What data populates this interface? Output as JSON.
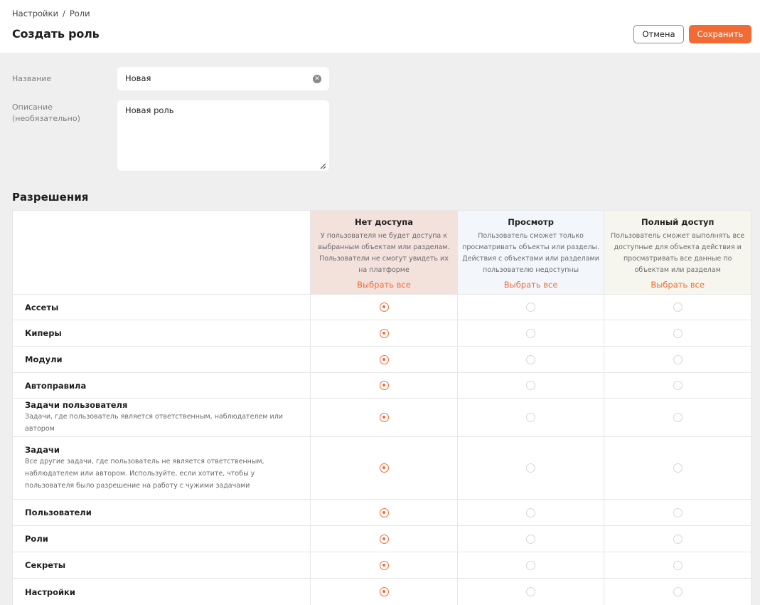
{
  "breadcrumb": {
    "parent": "Настройки",
    "separator": "/",
    "current": "Роли"
  },
  "page_title": "Создать роль",
  "actions": {
    "cancel_label": "Отмена",
    "save_label": "Сохранить"
  },
  "colors": {
    "accent": "#f26b35",
    "no_access_bg": "#f3e1dc",
    "view_bg": "#f3f7fc",
    "full_bg": "#f6f6ee"
  },
  "form": {
    "name_label": "Название",
    "name_value": "Новая",
    "description_label_1": "Описание",
    "description_label_2": "(необязательно)",
    "description_value": "Новая роль"
  },
  "permissions": {
    "title": "Разрешения",
    "columns": [
      {
        "title": "Нет доступа",
        "desc": "У пользователя не будет доступа к выбранным объектам или разделам. Пользователи не смогут увидеть их на платформе",
        "select_all": "Выбрать все"
      },
      {
        "title": "Просмотр",
        "desc": "Пользователь сможет только просматривать объекты или разделы. Действия с объектами или разделами пользователю недоступны",
        "select_all": "Выбрать все"
      },
      {
        "title": "Полный доступ",
        "desc": "Пользователь сможет выполнять все доступные для объекта действия и просматривать все данные по объектам или разделам",
        "select_all": "Выбрать все"
      }
    ],
    "rows": [
      {
        "title": "Ассеты",
        "desc": "",
        "selected": 0
      },
      {
        "title": "Киперы",
        "desc": "",
        "selected": 0
      },
      {
        "title": "Модули",
        "desc": "",
        "selected": 0
      },
      {
        "title": "Автоправила",
        "desc": "",
        "selected": 0
      },
      {
        "title": "Задачи пользователя",
        "desc": "Задачи, где пользователь является ответственным, наблюдателем или автором",
        "selected": 0
      },
      {
        "title": "Задачи",
        "desc": "Все другие задачи, где пользователь не является ответственным, наблюдателем или автором. Используйте, если хотите, чтобы у пользователя было разрешение на работу с чужими задачами",
        "selected": 0
      },
      {
        "title": "Пользователи",
        "desc": "",
        "selected": 0
      },
      {
        "title": "Роли",
        "desc": "",
        "selected": 0
      },
      {
        "title": "Секреты",
        "desc": "",
        "selected": 0
      },
      {
        "title": "Настройки",
        "desc": "",
        "selected": 0
      }
    ]
  }
}
